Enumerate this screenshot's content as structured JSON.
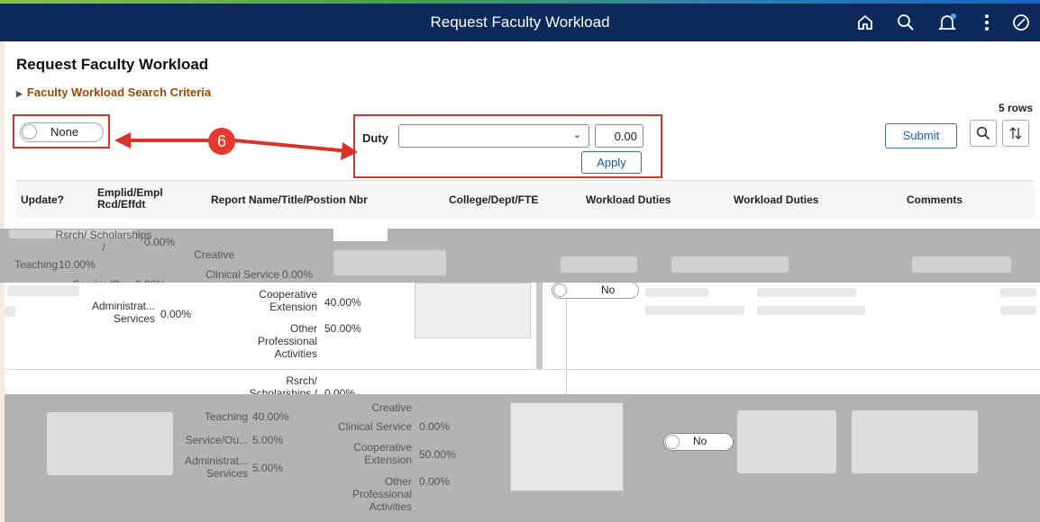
{
  "header": {
    "title": "Request Faculty Workload"
  },
  "page": {
    "title": "Request Faculty Workload",
    "search_criteria_label": "Faculty Workload Search Criteria",
    "row_count": "5 rows"
  },
  "toolbar": {
    "toggle_label": "None",
    "duty_label": "Duty",
    "duty_value": "",
    "amount": "0.00",
    "apply_label": "Apply",
    "submit_label": "Submit"
  },
  "annotation": {
    "step": "6"
  },
  "columns": [
    "Update?",
    "Emplid/Empl Rcd/Effdt",
    "Report Name/Title/Postion Nbr",
    "College/Dept/FTE",
    "Workload Duties",
    "Workload Duties",
    "Comments"
  ],
  "rows": [
    {
      "duties_a": [
        {
          "label": "Rsrch/ Scholarships /",
          "value": "0.00%"
        },
        {
          "label": "Teaching",
          "value": "10.00%"
        },
        {
          "label": "Service/Ou...",
          "value": "0.00%"
        },
        {
          "label": "Administrat... Services",
          "value": "0.00%"
        }
      ],
      "duties_b": [
        {
          "label": "Creative",
          "value": ""
        },
        {
          "label": "Clinical Service",
          "value": "0.00%"
        },
        {
          "label": "Cooperative Extension",
          "value": "40.00%"
        },
        {
          "label": "Other Professional Activities",
          "value": "50.00%"
        }
      ],
      "toggle": "No"
    },
    {
      "duties_a": [
        {
          "label": "Teaching",
          "value": "40.00%"
        },
        {
          "label": "Service/Ou...",
          "value": "5.00%"
        },
        {
          "label": "Administrat... Services",
          "value": "5.00%"
        }
      ],
      "duties_b": [
        {
          "label": "Rsrch/ Scholarships /",
          "value": "0.00%"
        },
        {
          "label": "Creative",
          "value": ""
        },
        {
          "label": "Clinical Service",
          "value": "0.00%"
        },
        {
          "label": "Cooperative Extension",
          "value": "50.00%"
        },
        {
          "label": "Other Professional Activities",
          "value": "0.00%"
        }
      ],
      "toggle": "No"
    }
  ],
  "colors": {
    "header_bg": "#0b2a5b",
    "link": "#9b4a0d",
    "annotation": "#d9342b"
  },
  "icons": [
    "home-icon",
    "search-icon",
    "bell-icon",
    "more-icon",
    "navbar-icon",
    "search-icon",
    "sort-icon",
    "chevron-down-icon"
  ]
}
